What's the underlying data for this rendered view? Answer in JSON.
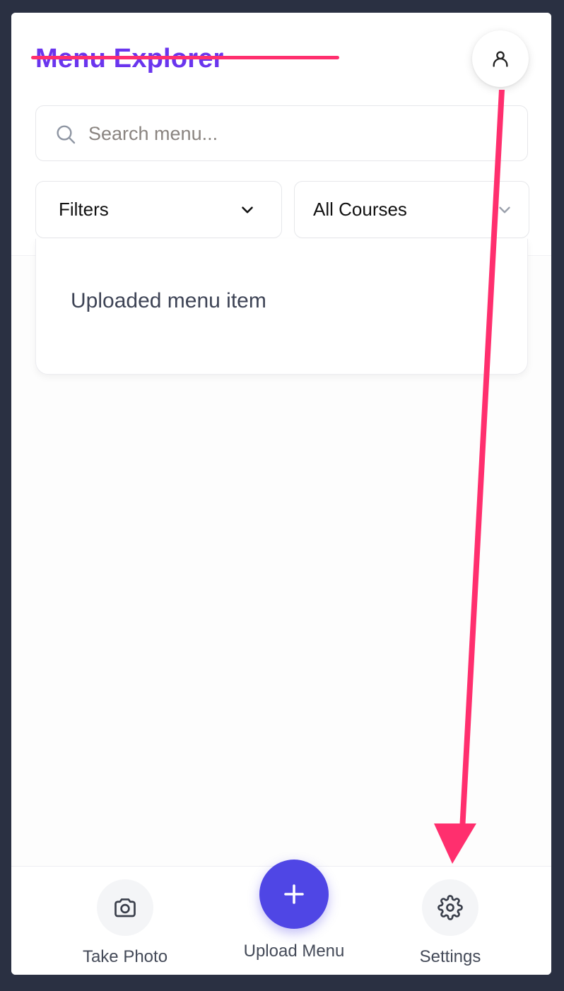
{
  "app": {
    "title": "Menu Explorer"
  },
  "search": {
    "placeholder": "Search menu..."
  },
  "filters": {
    "filters_label": "Filters",
    "course_selected": "All Courses"
  },
  "menu_items": [
    {
      "label": "Uploaded menu item"
    }
  ],
  "bottom_nav": {
    "take_photo_label": "Take Photo",
    "upload_menu_label": "Upload Menu",
    "settings_label": "Settings"
  },
  "icons": {
    "profile": "user-icon",
    "search": "search-icon",
    "chevron": "chevron-down-icon",
    "camera": "camera-icon",
    "plus": "plus-icon",
    "settings": "gear-icon"
  },
  "colors": {
    "brand": "#6a35ee",
    "fab": "#4f46e5",
    "annotation": "#ff2f6e",
    "frame": "#2a3042"
  }
}
